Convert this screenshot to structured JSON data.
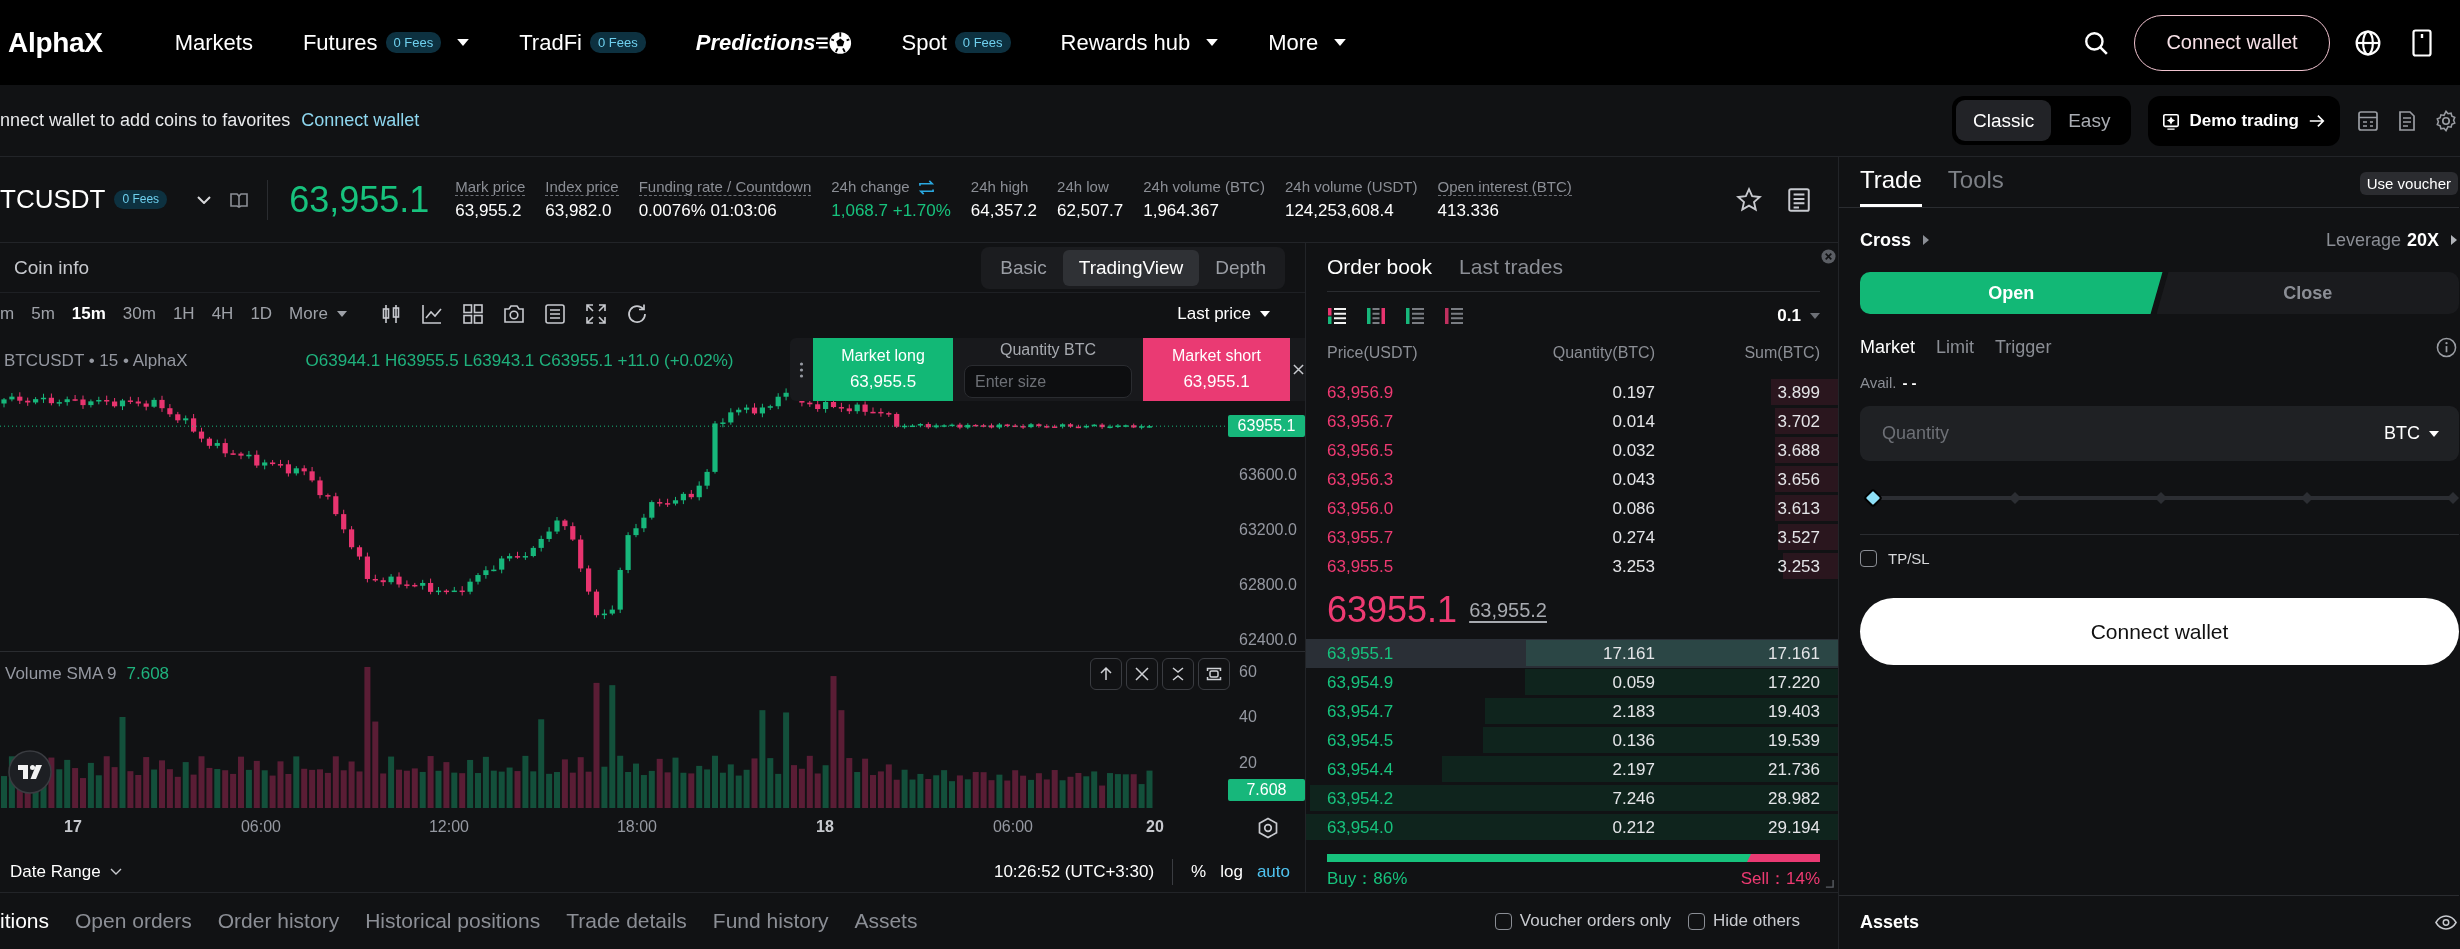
{
  "topnav": {
    "logo": "AlphaX",
    "items": [
      {
        "label": "Markets",
        "kind": "link",
        "has_menu": false
      },
      {
        "label": "Futures",
        "kind": "link",
        "badge": "0 Fees",
        "has_menu": true
      },
      {
        "label": "TradFi",
        "kind": "link",
        "badge": "0 Fees",
        "has_menu": false
      },
      {
        "label": "Predictions",
        "kind": "promo",
        "has_menu": false
      },
      {
        "label": "Spot",
        "kind": "link",
        "badge": "0 Fees",
        "has_menu": false
      },
      {
        "label": "Rewards hub",
        "kind": "link",
        "has_menu": true
      },
      {
        "label": "More",
        "kind": "link",
        "has_menu": true
      }
    ],
    "connect_button": "Connect wallet"
  },
  "favorites_bar": {
    "message": "nnect wallet to add coins to favorites",
    "link": "Connect wallet",
    "modes": [
      {
        "label": "Classic",
        "selected": true
      },
      {
        "label": "Easy",
        "selected": false
      }
    ],
    "demo_button": "Demo trading"
  },
  "ticker": {
    "symbol": "TCUSDT",
    "badge": "0 Fees",
    "last_price": "63,955.1",
    "stats": [
      {
        "label": "Mark price",
        "value": "63,955.2",
        "underlined": true,
        "positive": false,
        "switchable": false
      },
      {
        "label": "Index price",
        "value": "63,982.0",
        "underlined": true,
        "positive": false,
        "switchable": false
      },
      {
        "label": "Funding rate / Countdown",
        "value": "0.0076% 01:03:06",
        "underlined": true,
        "positive": false,
        "switchable": false
      },
      {
        "label": "24h change",
        "value": "1,068.7 +1.70%",
        "underlined": false,
        "positive": true,
        "switchable": true
      },
      {
        "label": "24h high",
        "value": "64,357.2",
        "underlined": false,
        "positive": false,
        "switchable": false
      },
      {
        "label": "24h low",
        "value": "62,507.7",
        "underlined": false,
        "positive": false,
        "switchable": false
      },
      {
        "label": "24h volume (BTC)",
        "value": "1,964.367",
        "underlined": false,
        "positive": false,
        "switchable": false
      },
      {
        "label": "24h volume (USDT)",
        "value": "124,253,608.4",
        "underlined": false,
        "positive": false,
        "switchable": false
      },
      {
        "label": "Open interest (BTC)",
        "value": "413.336",
        "underlined": true,
        "positive": false,
        "switchable": false
      }
    ]
  },
  "chart": {
    "panel_label": "Coin info",
    "views": [
      {
        "label": "Basic",
        "selected": false
      },
      {
        "label": "TradingView",
        "selected": true
      },
      {
        "label": "Depth",
        "selected": false
      }
    ],
    "intervals": [
      {
        "label": "m",
        "selected": false
      },
      {
        "label": "5m",
        "selected": false
      },
      {
        "label": "15m",
        "selected": true
      },
      {
        "label": "30m",
        "selected": false
      },
      {
        "label": "1H",
        "selected": false
      },
      {
        "label": "4H",
        "selected": false
      },
      {
        "label": "1D",
        "selected": false
      }
    ],
    "more": "More",
    "price_source": "Last price",
    "legend": {
      "symbol": "BTCUSDT • 15 • AlphaX",
      "ohlc": "O63944.1 H63955.5 L63943.1 C63955.1 +11.0 (+0.02%)"
    },
    "quick_order": {
      "long_label": "Market long",
      "long_price": "63,955.5",
      "quantity_label": "Quantity BTC",
      "quantity_placeholder": "Enter size",
      "short_label": "Market short",
      "short_price": "63,955.1"
    },
    "price_axis": [
      "63600.0",
      "63200.0",
      "62800.0",
      "62400.0"
    ],
    "last_price_tag": "63955.1",
    "volume": {
      "label": "Volume SMA 9",
      "value": "7.608",
      "axis": [
        "60",
        "40",
        "20"
      ],
      "tag": "7.608"
    },
    "time_axis": [
      {
        "label": "17",
        "kind": "day"
      },
      {
        "label": "06:00",
        "kind": "time"
      },
      {
        "label": "12:00",
        "kind": "time"
      },
      {
        "label": "18:00",
        "kind": "time"
      },
      {
        "label": "18",
        "kind": "day"
      },
      {
        "label": "06:00",
        "kind": "time"
      },
      {
        "label": "20",
        "kind": "day"
      }
    ],
    "date_range": "Date Range",
    "clock": "10:26:52 (UTC+3:30)",
    "scale_options": [
      {
        "label": "%",
        "selected": false
      },
      {
        "label": "log",
        "selected": false
      },
      {
        "label": "auto",
        "selected": true
      }
    ]
  },
  "order_book": {
    "tabs": [
      {
        "label": "Order book",
        "selected": true
      },
      {
        "label": "Last trades",
        "selected": false
      }
    ],
    "views": [
      {
        "kind": "both",
        "selected": true
      },
      {
        "kind": "split",
        "selected": false
      },
      {
        "kind": "bids",
        "selected": false
      },
      {
        "kind": "asks",
        "selected": false
      }
    ],
    "tick_size": "0.1",
    "columns": [
      "Price(USDT)",
      "Quantity(BTC)",
      "Sum(BTC)"
    ],
    "asks": [
      {
        "price": "63,956.9",
        "quantity": "0.197",
        "sum": "3.899",
        "level": 0.126,
        "hovered": false
      },
      {
        "price": "63,956.7",
        "quantity": "0.014",
        "sum": "3.702",
        "level": 0.118,
        "hovered": false
      },
      {
        "price": "63,956.5",
        "quantity": "0.032",
        "sum": "3.688",
        "level": 0.118,
        "hovered": false
      },
      {
        "price": "63,956.3",
        "quantity": "0.043",
        "sum": "3.656",
        "level": 0.118,
        "hovered": false
      },
      {
        "price": "63,956.0",
        "quantity": "0.086",
        "sum": "3.613",
        "level": 0.118,
        "hovered": false
      },
      {
        "price": "63,955.7",
        "quantity": "0.274",
        "sum": "3.527",
        "level": 0.113,
        "hovered": false
      },
      {
        "price": "63,955.5",
        "quantity": "3.253",
        "sum": "3.253",
        "level": 0.103,
        "hovered": false
      }
    ],
    "last_price": "63955.1",
    "mark_price": "63,955.2",
    "bids": [
      {
        "price": "63,955.1",
        "quantity": "17.161",
        "sum": "17.161",
        "level": 0.587,
        "hovered": true
      },
      {
        "price": "63,954.9",
        "quantity": "0.059",
        "sum": "17.220",
        "level": 0.589,
        "hovered": false
      },
      {
        "price": "63,954.7",
        "quantity": "2.183",
        "sum": "19.403",
        "level": 0.664,
        "hovered": false
      },
      {
        "price": "63,954.5",
        "quantity": "0.136",
        "sum": "19.539",
        "level": 0.668,
        "hovered": false
      },
      {
        "price": "63,954.4",
        "quantity": "2.197",
        "sum": "21.736",
        "level": 0.745,
        "hovered": false
      },
      {
        "price": "63,954.2",
        "quantity": "7.246",
        "sum": "28.982",
        "level": 0.992,
        "hovered": false
      },
      {
        "price": "63,954.0",
        "quantity": "0.212",
        "sum": "29.194",
        "level": 1.0,
        "hovered": false
      }
    ],
    "buy_share": {
      "level": 0.86,
      "buy_label": "Buy：86%",
      "sell_label": "Sell：14%"
    }
  },
  "bottom_bar": {
    "tabs": [
      {
        "label": "itions",
        "selected": true
      },
      {
        "label": "Open orders",
        "selected": false
      },
      {
        "label": "Order history",
        "selected": false
      },
      {
        "label": "Historical positions",
        "selected": false
      },
      {
        "label": "Trade details",
        "selected": false
      },
      {
        "label": "Fund history",
        "selected": false
      },
      {
        "label": "Assets",
        "selected": false
      }
    ],
    "filters": [
      {
        "label": "Voucher orders only",
        "checked": false
      },
      {
        "label": "Hide others",
        "checked": false
      }
    ]
  },
  "trade_panel": {
    "tabs": [
      {
        "label": "Trade",
        "selected": true
      },
      {
        "label": "Tools",
        "selected": false
      }
    ],
    "voucher": "Use voucher",
    "margin_mode": "Cross",
    "leverage_label": "Leverage",
    "leverage": "20X",
    "sides": [
      {
        "label": "Open",
        "selected": true
      },
      {
        "label": "Close",
        "selected": false
      }
    ],
    "order_types": [
      {
        "label": "Market",
        "selected": true
      },
      {
        "label": "Limit",
        "selected": false
      },
      {
        "label": "Trigger",
        "selected": false
      }
    ],
    "available_label": "Avail.",
    "available_value": "- -",
    "quantity": {
      "placeholder": "Quantity",
      "unit": "BTC"
    },
    "slider": {
      "level": 0
    },
    "tpsl": {
      "label": "TP/SL",
      "checked": false
    },
    "submit": "Connect wallet",
    "assets_label": "Assets"
  }
}
